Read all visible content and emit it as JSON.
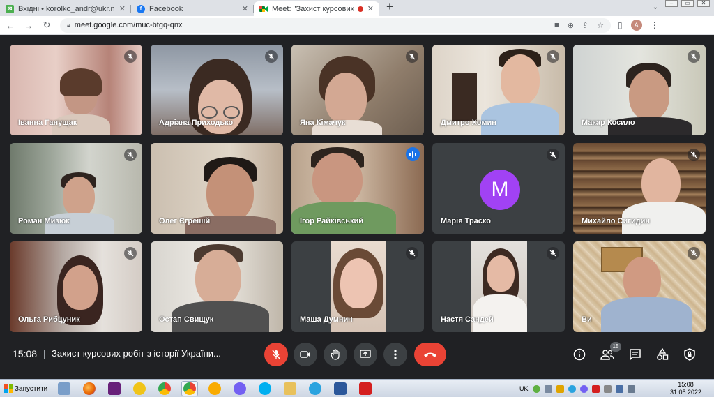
{
  "browser": {
    "tabs": [
      {
        "title": "Вхідні • korolko_andr@ukr.net",
        "favicon": "ukr-net-mail-icon",
        "active": false
      },
      {
        "title": "Facebook",
        "favicon": "facebook-icon",
        "active": false
      },
      {
        "title": "Meet: \"Захист курсових робі",
        "favicon": "google-meet-icon",
        "active": true,
        "recording": true
      }
    ],
    "new_tab": "+",
    "url": "meet.google.com/muc-btgq-qnx",
    "profile_initial": "A"
  },
  "meet": {
    "participants": [
      {
        "name": "Іванна Ганущак",
        "muted": true
      },
      {
        "name": "Адріана Приходько",
        "muted": true
      },
      {
        "name": "Яна Кімачук",
        "muted": true
      },
      {
        "name": "Дмитро Хомин",
        "muted": true
      },
      {
        "name": "Макар Косило",
        "muted": true
      },
      {
        "name": "Роман Мизюк",
        "muted": true
      },
      {
        "name": "Олег Єгрешій",
        "muted": false
      },
      {
        "name": "Ігор Райківський",
        "muted": false,
        "speaking": true
      },
      {
        "name": "Марія Траско",
        "muted": true,
        "avatar_letter": "M"
      },
      {
        "name": "Михайло Сигидин",
        "muted": true
      },
      {
        "name": "Ольга Рибцуник",
        "muted": true
      },
      {
        "name": "Остап Свищук",
        "muted": false
      },
      {
        "name": "Маша Думнич",
        "muted": true
      },
      {
        "name": "Настя Сандей",
        "muted": true
      },
      {
        "name": "Ви",
        "muted": true
      }
    ],
    "time": "15:08",
    "meeting_title": "Захист курсових робіт з історії України...",
    "people_count": "15",
    "colors": {
      "danger": "#ea4335",
      "speaking": "#1a73e8",
      "avatar": "#a142f4"
    }
  },
  "taskbar": {
    "start_label": "Запустити",
    "language": "UK",
    "time": "15:08",
    "date": "31.05.2022"
  }
}
